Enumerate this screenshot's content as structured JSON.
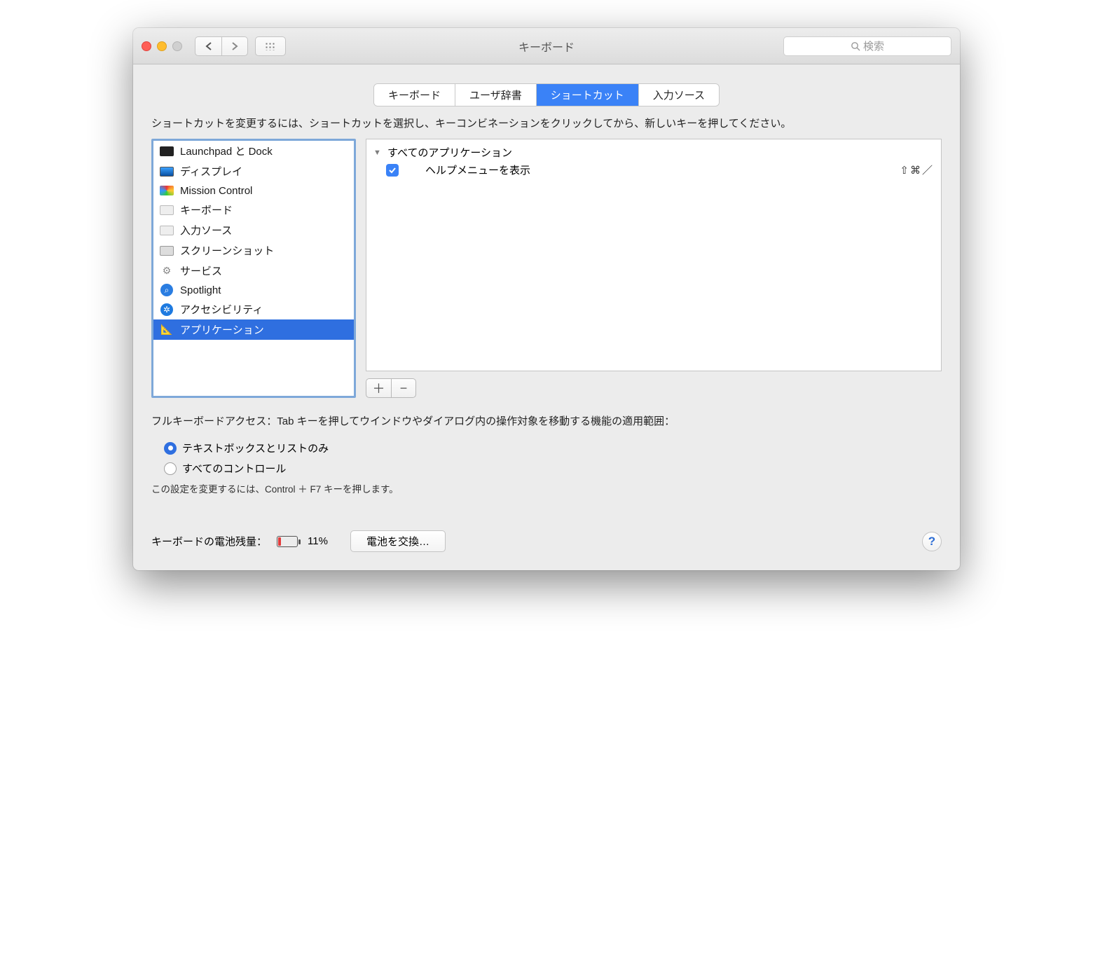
{
  "window": {
    "title": "キーボード"
  },
  "search": {
    "placeholder": "検索"
  },
  "tabs": [
    {
      "label": "キーボード"
    },
    {
      "label": "ユーザ辞書"
    },
    {
      "label": "ショートカット",
      "active": true
    },
    {
      "label": "入力ソース"
    }
  ],
  "instruction": "ショートカットを変更するには、ショートカットを選択し、キーコンビネーションをクリックしてから、新しいキーを押してください。",
  "categories": [
    {
      "label": "Launchpad と Dock",
      "icon": "launchpad-icon"
    },
    {
      "label": "ディスプレイ",
      "icon": "display-icon"
    },
    {
      "label": "Mission Control",
      "icon": "mission-control-icon"
    },
    {
      "label": "キーボード",
      "icon": "keyboard-icon"
    },
    {
      "label": "入力ソース",
      "icon": "input-source-icon"
    },
    {
      "label": "スクリーンショット",
      "icon": "screenshot-icon"
    },
    {
      "label": "サービス",
      "icon": "services-icon"
    },
    {
      "label": "Spotlight",
      "icon": "spotlight-icon"
    },
    {
      "label": "アクセシビリティ",
      "icon": "accessibility-icon"
    },
    {
      "label": "アプリケーション",
      "icon": "applications-icon",
      "selected": true
    }
  ],
  "detail": {
    "group": "すべてのアプリケーション",
    "items": [
      {
        "label": "ヘルプメニューを表示",
        "checked": true,
        "shortcut": "⇧⌘／"
      }
    ]
  },
  "fka": {
    "text": "フルキーボードアクセス：Tab キーを押してウインドウやダイアログ内の操作対象を移動する機能の適用範囲：",
    "options": [
      {
        "label": "テキストボックスとリストのみ",
        "selected": true
      },
      {
        "label": "すべてのコントロール",
        "selected": false
      }
    ],
    "hint": "この設定を変更するには、Control ＋ F7 キーを押します。"
  },
  "footer": {
    "battery_label": "キーボードの電池残量：",
    "battery_pct": "11%",
    "replace_button": "電池を交換…"
  }
}
